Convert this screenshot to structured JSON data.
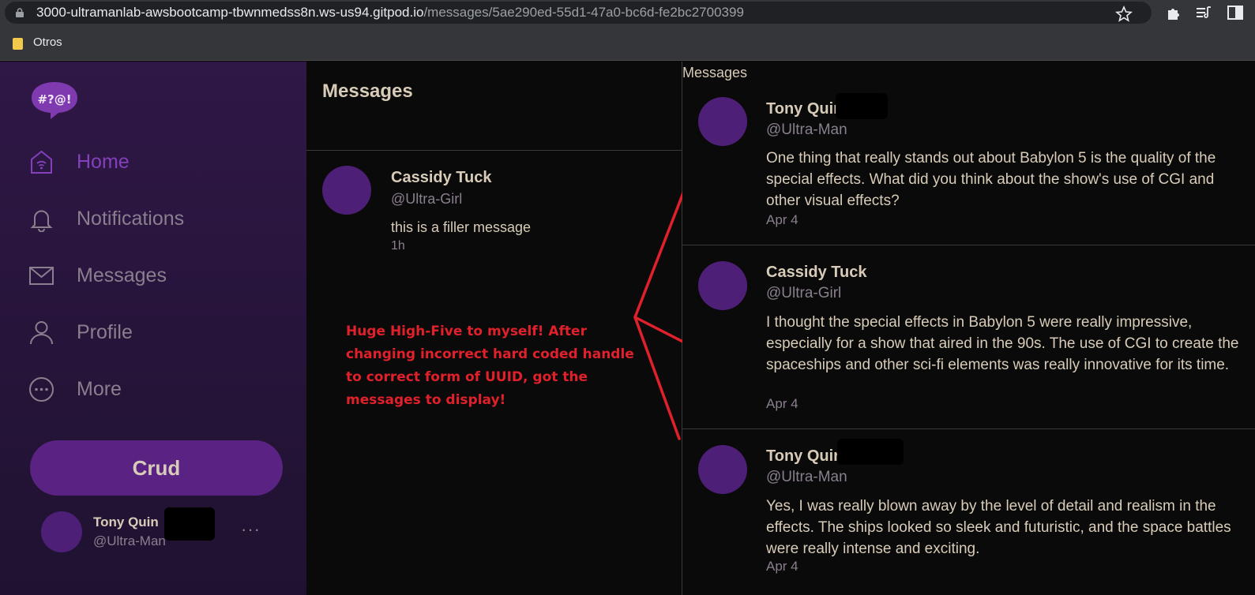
{
  "browser": {
    "url_host": "3000-ultramanlab-awsbootcamp-tbwnmedss8n.ws-us94.gitpod.io",
    "url_path": "/messages/5ae290ed-55d1-47a0-bc6d-fe2bc2700399",
    "bookmark_folder": "Otros",
    "icons": [
      "lock-icon",
      "star-icon",
      "extensions-icon",
      "reading-list-icon",
      "sidebar-icon"
    ]
  },
  "sidebar": {
    "logo_text": "#?@!",
    "nav": [
      {
        "label": "Home",
        "icon": "home-icon",
        "active": true
      },
      {
        "label": "Notifications",
        "icon": "bell-icon"
      },
      {
        "label": "Messages",
        "icon": "envelope-icon"
      },
      {
        "label": "Profile",
        "icon": "person-icon"
      },
      {
        "label": "More",
        "icon": "more-circle-icon"
      }
    ],
    "crud_label": "Crud",
    "profile": {
      "name": "Tony Quin",
      "handle": "@Ultra-Man",
      "more": "···"
    }
  },
  "groups": {
    "title": "Messages",
    "items": [
      {
        "name": "Cassidy Tuck",
        "handle": "@Ultra-Girl",
        "message": "this is a filler message",
        "time": "1h"
      }
    ]
  },
  "annotation": "Huge High-Five to myself! After changing incorrect hard coded handle to correct form of UUID, got the messages to display!",
  "messages": {
    "header": "Messages",
    "items": [
      {
        "name": "Tony Quin",
        "handle": "@Ultra-Man",
        "body": "One thing that really stands out about Babylon 5 is the quality of the special effects. What did you think about the show's use of CGI and other visual effects?",
        "time": "Apr 4"
      },
      {
        "name": "Cassidy Tuck",
        "handle": "@Ultra-Girl",
        "body": "I thought the special effects in Babylon 5 were really impressive, especially for a show that aired in the 90s. The use of CGI to create the spaceships and other sci-fi elements was really innovative for its time.",
        "time": "Apr 4"
      },
      {
        "name": "Tony Quin",
        "handle": "@Ultra-Man",
        "body": "Yes, I was really blown away by the level of detail and realism in the effects. The ships looked so sleek and futuristic, and the space battles were really intense and exciting.",
        "time": "Apr 4"
      }
    ]
  },
  "colors": {
    "accent": "#5a2383",
    "avatar": "#4e1f76",
    "annotation": "#e0202a"
  }
}
